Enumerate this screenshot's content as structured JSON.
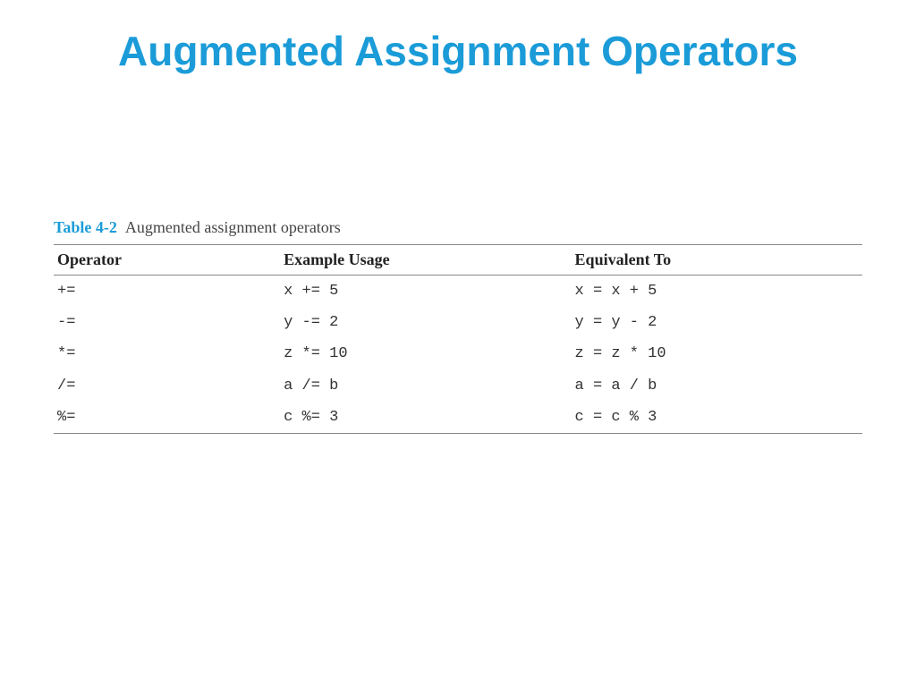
{
  "slide": {
    "title": "Augmented Assignment Operators"
  },
  "table": {
    "caption_prefix": "Table 4-2",
    "caption_text": "Augmented assignment operators",
    "headers": {
      "operator": "Operator",
      "usage": "Example Usage",
      "equivalent": "Equivalent To"
    },
    "rows": [
      {
        "operator": "+=",
        "usage": "x += 5",
        "equivalent": "x = x + 5"
      },
      {
        "operator": "-=",
        "usage": "y -= 2",
        "equivalent": "y = y - 2"
      },
      {
        "operator": "*=",
        "usage": "z *= 10",
        "equivalent": "z = z * 10"
      },
      {
        "operator": "/=",
        "usage": "a /= b",
        "equivalent": "a = a / b"
      },
      {
        "operator": "%=",
        "usage": "c %= 3",
        "equivalent": "c = c % 3"
      }
    ]
  },
  "chart_data": {
    "type": "table",
    "title": "Table 4-2 Augmented assignment operators",
    "columns": [
      "Operator",
      "Example Usage",
      "Equivalent To"
    ],
    "rows": [
      [
        "+=",
        "x += 5",
        "x = x + 5"
      ],
      [
        "-=",
        "y -= 2",
        "y = y - 2"
      ],
      [
        "*=",
        "z *= 10",
        "z = z * 10"
      ],
      [
        "/=",
        "a /= b",
        "a = a / b"
      ],
      [
        "%=",
        "c %= 3",
        "c = c % 3"
      ]
    ]
  }
}
